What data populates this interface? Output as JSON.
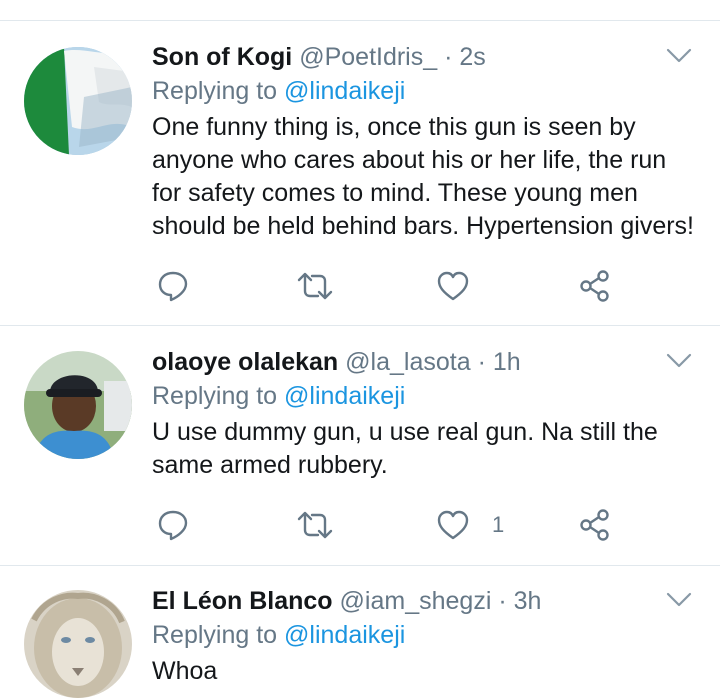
{
  "tweets": [
    {
      "name": "Son of Kogi",
      "handle": "@PoetIdris_",
      "separator": "·",
      "time": "2s",
      "reply_prefix": "Replying to",
      "reply_to": "@lindaikeji",
      "text": "One funny thing is, once this gun is seen by anyone who cares about his or her life, the run for safety comes to mind. These young men should be held behind bars. Hypertension givers!",
      "like_count": ""
    },
    {
      "name": "olaoye olalekan",
      "handle": "@la_lasota",
      "separator": "·",
      "time": "1h",
      "reply_prefix": "Replying to",
      "reply_to": "@lindaikeji",
      "text": "U use dummy gun, u use real gun. Na still the same armed rubbery.",
      "like_count": "1"
    },
    {
      "name": "El Léon Blanco",
      "handle": "@iam_shegzi",
      "separator": "·",
      "time": "3h",
      "reply_prefix": "Replying to",
      "reply_to": "@lindaikeji",
      "text": "Whoa",
      "like_count": ""
    }
  ],
  "icons": {
    "reply": "reply-icon",
    "retweet": "retweet-icon",
    "like": "heart-icon",
    "share": "share-icon",
    "menu": "chevron-down-icon"
  },
  "colors": {
    "icon": "#657786",
    "mention": "#1b95e0",
    "divider": "#e1e8ed"
  }
}
